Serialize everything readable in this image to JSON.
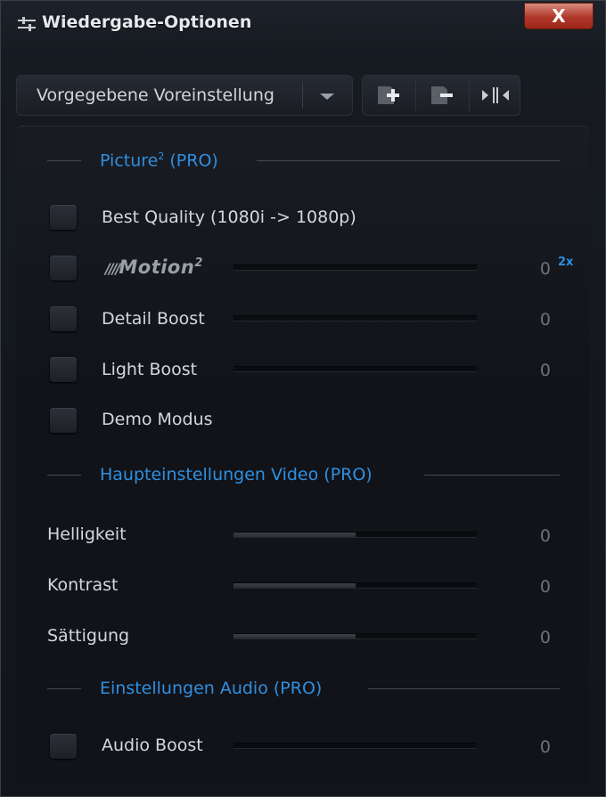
{
  "window": {
    "title": "Wiedergabe-Optionen",
    "close_label": "X"
  },
  "preset": {
    "selected": "Vorgegebene Voreinstellung"
  },
  "toolbar": {
    "icons": [
      "add-preset-icon",
      "remove-preset-icon",
      "compare-split-icon"
    ]
  },
  "sections": {
    "picture": {
      "title": "Picture",
      "title_sup": "2",
      "title_suffix": " (PRO)",
      "items": {
        "best_quality": {
          "label": "Best Quality (1080i -> 1080p)"
        },
        "motion": {
          "label": "Motion",
          "label_sup": "2",
          "value": "0",
          "badge": "2x",
          "level": 0
        },
        "detail_boost": {
          "label": "Detail Boost",
          "value": "0",
          "level": 0
        },
        "light_boost": {
          "label": "Light Boost",
          "value": "0",
          "level": 0
        },
        "demo_modus": {
          "label": "Demo Modus"
        }
      }
    },
    "video": {
      "title": "Haupteinstellungen Video (PRO)",
      "items": {
        "helligkeit": {
          "label": "Helligkeit",
          "value": "0",
          "level": 0.5
        },
        "kontrast": {
          "label": "Kontrast",
          "value": "0",
          "level": 0.5
        },
        "saettigung": {
          "label": "Sättigung",
          "value": "0",
          "level": 0.5
        }
      }
    },
    "audio": {
      "title": "Einstellungen Audio (PRO)",
      "items": {
        "audio_boost": {
          "label": "Audio Boost",
          "value": "0",
          "level": 0
        }
      }
    }
  },
  "colors": {
    "accent": "#2f8fe0",
    "close_red": "#b0382a",
    "background": "#12151b"
  }
}
